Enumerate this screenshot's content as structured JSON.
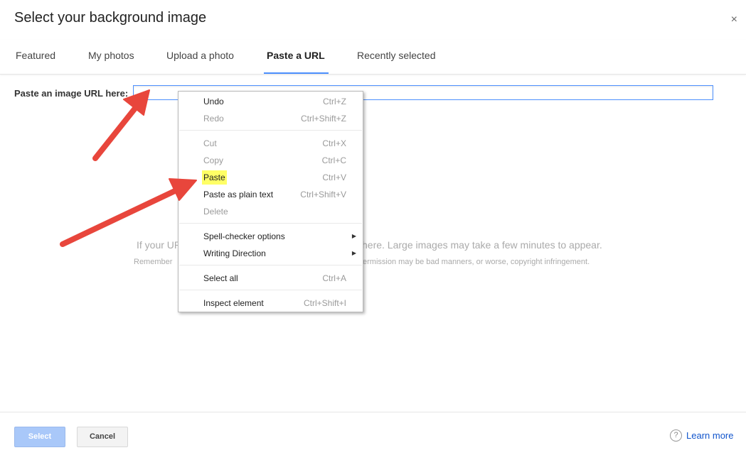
{
  "dialog": {
    "title": "Select your background image",
    "close_label": "×"
  },
  "tabs": [
    {
      "label": "Featured",
      "active": false
    },
    {
      "label": "My photos",
      "active": false
    },
    {
      "label": "Upload a photo",
      "active": false
    },
    {
      "label": "Paste a URL",
      "active": true
    },
    {
      "label": "Recently selected",
      "active": false
    }
  ],
  "url_form": {
    "label": "Paste an image URL here:",
    "value": ""
  },
  "help_text": {
    "line1_left": "If your UR",
    "line1_right": "here. Large images may take a few minutes to appear.",
    "line2_left": "Remember",
    "line2_right": "ermission may be bad manners, or worse, copyright infringement."
  },
  "context_menu": {
    "items": [
      {
        "label": "Undo",
        "shortcut": "Ctrl+Z",
        "enabled": true
      },
      {
        "label": "Redo",
        "shortcut": "Ctrl+Shift+Z",
        "enabled": false
      },
      {
        "label": "Cut",
        "shortcut": "Ctrl+X",
        "enabled": false
      },
      {
        "label": "Copy",
        "shortcut": "Ctrl+C",
        "enabled": false
      },
      {
        "label": "Paste",
        "shortcut": "Ctrl+V",
        "enabled": true,
        "highlighted": true
      },
      {
        "label": "Paste as plain text",
        "shortcut": "Ctrl+Shift+V",
        "enabled": true
      },
      {
        "label": "Delete",
        "shortcut": "",
        "enabled": false
      },
      {
        "label": "Spell-checker options",
        "shortcut": "",
        "enabled": true,
        "submenu": true
      },
      {
        "label": "Writing Direction",
        "shortcut": "",
        "enabled": true,
        "submenu": true
      },
      {
        "label": "Select all",
        "shortcut": "Ctrl+A",
        "enabled": true
      },
      {
        "label": "Inspect element",
        "shortcut": "Ctrl+Shift+I",
        "enabled": true
      }
    ],
    "submenu_arrow": "▶",
    "highlight_color": "#ffff66"
  },
  "footer": {
    "select_label": "Select",
    "cancel_label": "Cancel",
    "help_icon": "?",
    "learn_more_label": "Learn more"
  },
  "colors": {
    "accent": "#4d90fe",
    "annotation_arrow": "#e8463c",
    "link": "#1155cc"
  },
  "icons": {
    "help": "question-circle-icon",
    "close": "close-icon",
    "annotation": "red-arrow"
  }
}
